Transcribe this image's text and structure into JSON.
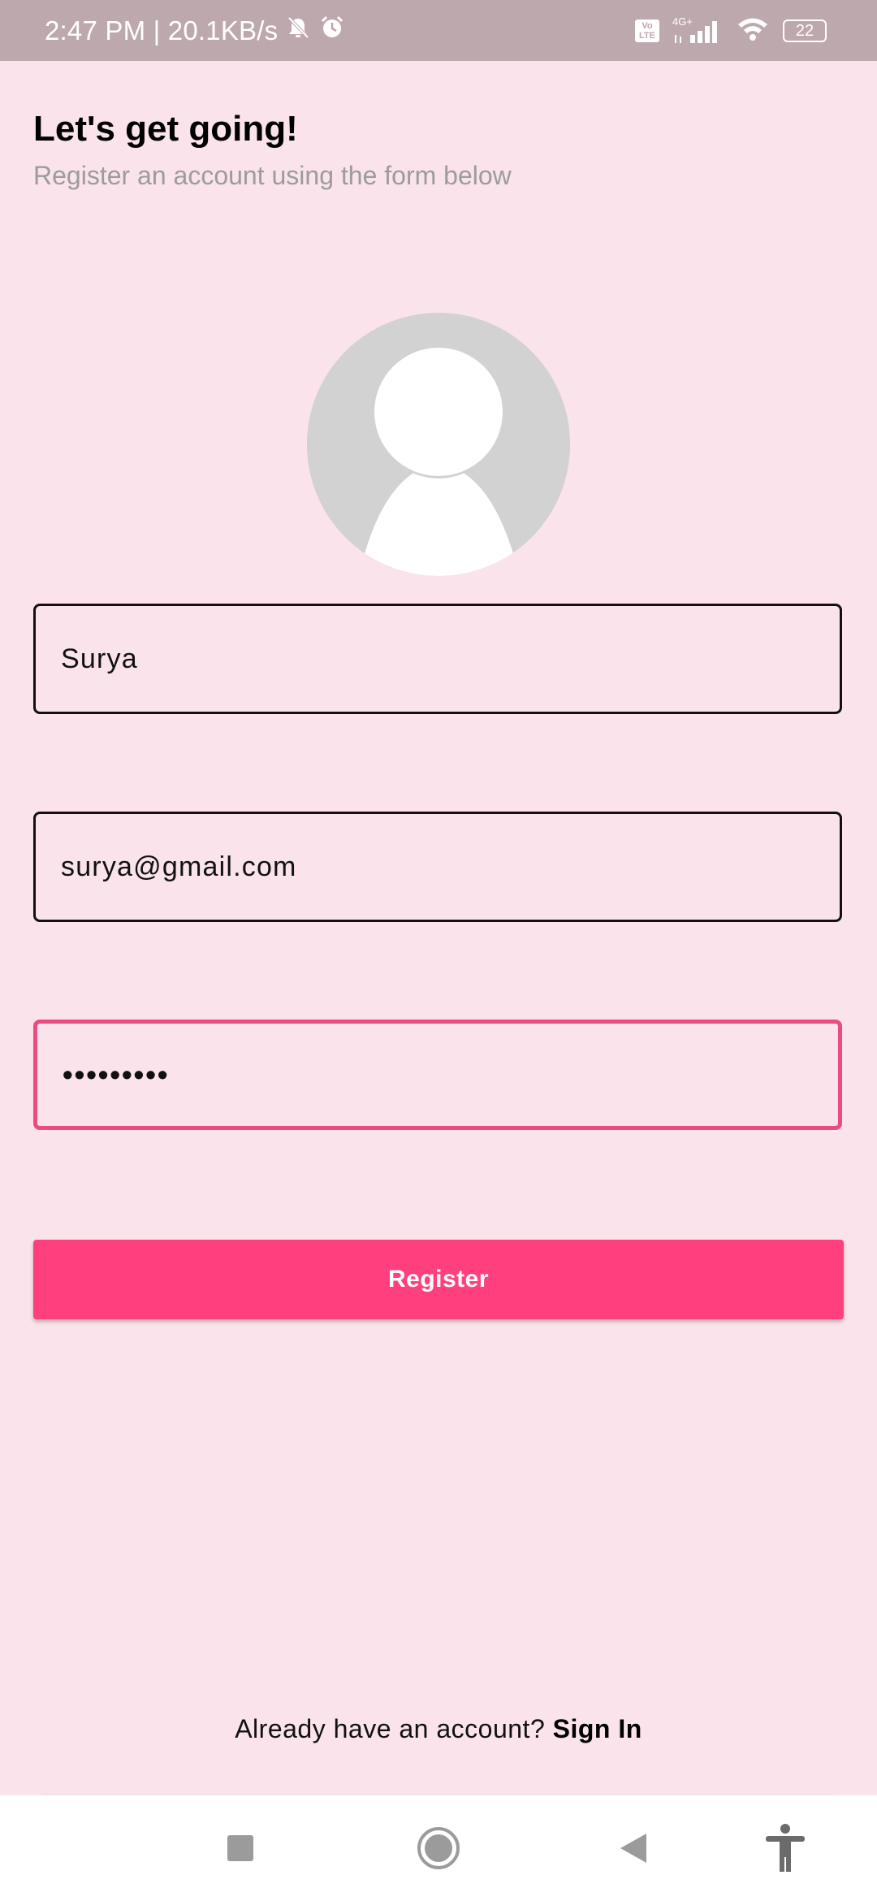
{
  "status_bar": {
    "time_speed": "2:47 PM | 20.1KB/s",
    "volte_top": "Vo",
    "volte_bottom": "LTE",
    "network": "4G+",
    "battery": "22",
    "icons": [
      "mute-icon",
      "alarm-icon",
      "volte-icon",
      "signal-icon",
      "wifi-icon",
      "battery-icon"
    ]
  },
  "header": {
    "title": "Let's get going!",
    "subtitle": "Register an account using the form below"
  },
  "avatar": {
    "icon": "person-icon"
  },
  "form": {
    "name_value": "Surya",
    "email_value": "surya@gmail.com",
    "password_value": "•••••••••",
    "register_label": "Register"
  },
  "footer": {
    "prompt": "Already have an account?",
    "signin_label": "Sign In"
  },
  "nav_bar": {
    "icons": [
      "recents-icon",
      "home-icon",
      "back-icon",
      "accessibility-icon"
    ]
  },
  "colors": {
    "background": "#fae3ea",
    "status_bar": "#bda8ae",
    "accent": "#ff3f7e",
    "focus_border": "#ea4b80"
  }
}
